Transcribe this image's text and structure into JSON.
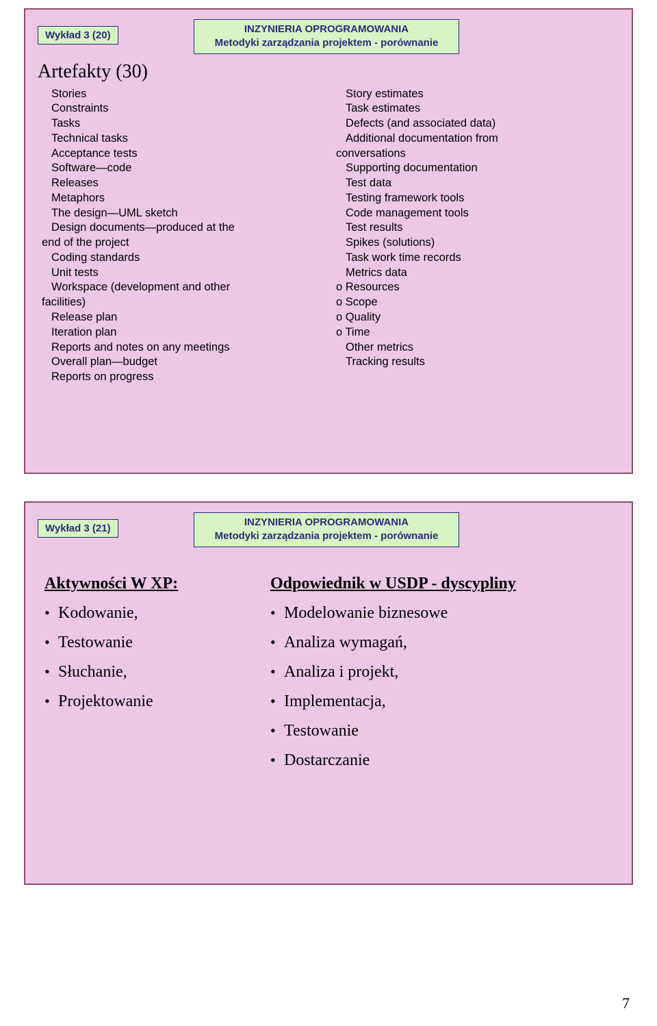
{
  "slide1": {
    "label": "Wykład 3 (20)",
    "header_line1": "INZYNIERIA OPROGRAMOWANIA",
    "header_line2": "Metodyki zarządzania projektem - porównanie",
    "title": "Artefakty (30)",
    "left": {
      "l0": "Stories",
      "l1": "Constraints",
      "l2": "Tasks",
      "l3": "Technical tasks",
      "l4": "Acceptance tests",
      "l5": "Software—code",
      "l6": "Releases",
      "l7": "Metaphors",
      "l8": "The design—UML sketch",
      "l9a": "Design documents—produced at the",
      "l9b": "end of the project",
      "l10": "Coding standards",
      "l11": "Unit tests",
      "l12a": "Workspace (development and other",
      "l12b": "facilities)",
      "l13": "Release plan",
      "l14": "Iteration plan",
      "l15": "Reports and notes on any meetings",
      "l16": "Overall plan—budget",
      "l17": "Reports on progress"
    },
    "right": {
      "r0": "Story estimates",
      "r1": "Task estimates",
      "r2": "Defects (and associated data)",
      "r3a": "Additional documentation from",
      "r3b": "conversations",
      "r4": "Supporting documentation",
      "r5": "Test data",
      "r6": "Testing framework tools",
      "r7": "Code management tools",
      "r8": "Test results",
      "r9": "Spikes (solutions)",
      "r10": "Task work time records",
      "r11": "Metrics data",
      "r12": "o Resources",
      "r13": "o Scope",
      "r14": "o Quality",
      "r15": "o Time",
      "r16": "Other metrics",
      "r17": "Tracking results"
    }
  },
  "slide2": {
    "label": "Wykład 3 (21)",
    "header_line1": "INZYNIERIA OPROGRAMOWANIA",
    "header_line2": "Metodyki zarządzania projektem - porównanie",
    "left_heading": "Aktywności W XP:",
    "left_items": {
      "i0": "Kodowanie,",
      "i1": "Testowanie",
      "i2": "Słuchanie,",
      "i3": "Projektowanie"
    },
    "right_heading": "Odpowiednik w USDP - dyscypliny",
    "right_items": {
      "i0": "Modelowanie biznesowe",
      "i1": "Analiza wymagań,",
      "i2": "Analiza i projekt,",
      "i3": "Implementacja,",
      "i4": "Testowanie",
      "i5": "Dostarczanie"
    }
  },
  "page_number": "7"
}
